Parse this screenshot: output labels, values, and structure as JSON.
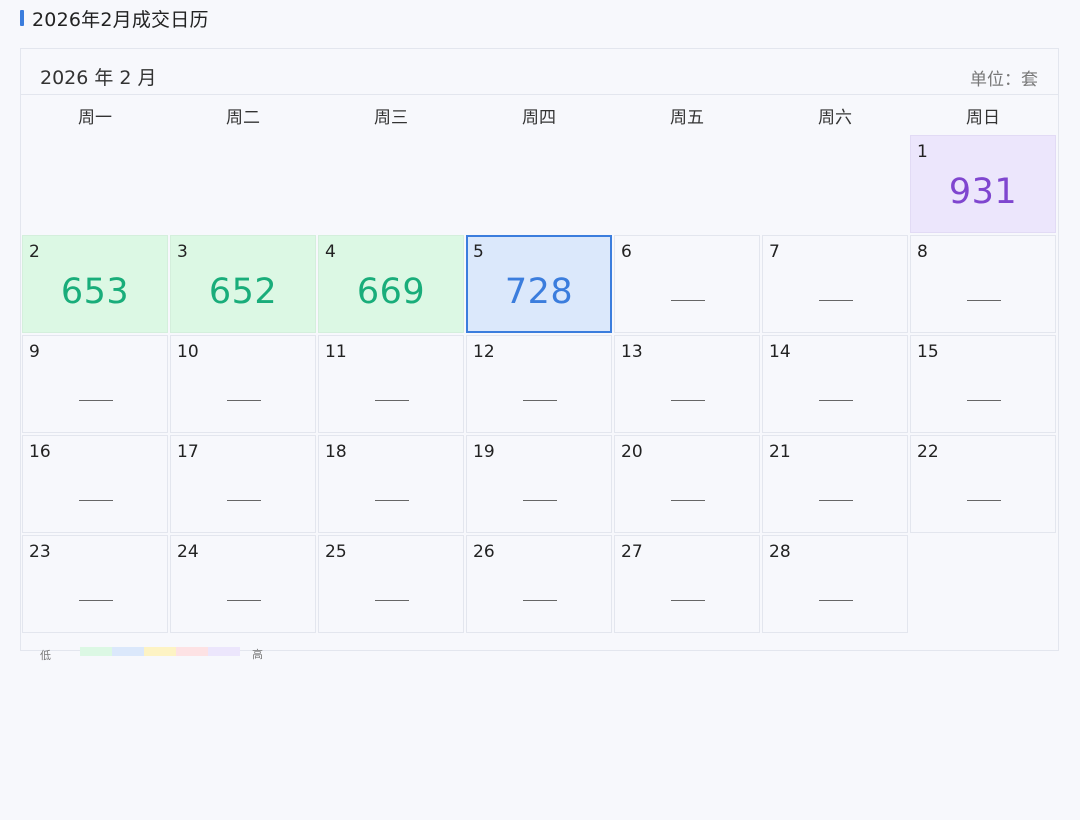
{
  "page_title": "2026年2月成交日历",
  "calendar": {
    "month_label": "2026 年 2 月",
    "unit_label": "单位：套",
    "weekdays": [
      "周一",
      "周二",
      "周三",
      "周四",
      "周五",
      "周六",
      "周日"
    ],
    "empty_mark": "——",
    "days": [
      {
        "day": "1",
        "value": "931",
        "level": "purple"
      },
      {
        "day": "2",
        "value": "653",
        "level": "green"
      },
      {
        "day": "3",
        "value": "652",
        "level": "green"
      },
      {
        "day": "4",
        "value": "669",
        "level": "green"
      },
      {
        "day": "5",
        "value": "728",
        "level": "blue",
        "selected": true
      },
      {
        "day": "6",
        "value": null
      },
      {
        "day": "7",
        "value": null
      },
      {
        "day": "8",
        "value": null
      },
      {
        "day": "9",
        "value": null
      },
      {
        "day": "10",
        "value": null
      },
      {
        "day": "11",
        "value": null
      },
      {
        "day": "12",
        "value": null
      },
      {
        "day": "13",
        "value": null
      },
      {
        "day": "14",
        "value": null
      },
      {
        "day": "15",
        "value": null
      },
      {
        "day": "16",
        "value": null
      },
      {
        "day": "17",
        "value": null
      },
      {
        "day": "18",
        "value": null
      },
      {
        "day": "19",
        "value": null
      },
      {
        "day": "20",
        "value": null
      },
      {
        "day": "21",
        "value": null
      },
      {
        "day": "22",
        "value": null
      },
      {
        "day": "23",
        "value": null
      },
      {
        "day": "24",
        "value": null
      },
      {
        "day": "25",
        "value": null
      },
      {
        "day": "26",
        "value": null
      },
      {
        "day": "27",
        "value": null
      },
      {
        "day": "28",
        "value": null
      }
    ]
  },
  "legend": {
    "low_label": "低",
    "high_label": "高",
    "colors": [
      "#dcf8e4",
      "#dbe8fb",
      "#fdf3c4",
      "#fde2e4",
      "#ece6fc"
    ]
  },
  "colors": {
    "accent": "#3b7ddd",
    "green_text": "#19ad7a",
    "blue_text": "#3b7ddd",
    "purple_text": "#7f46cf"
  }
}
